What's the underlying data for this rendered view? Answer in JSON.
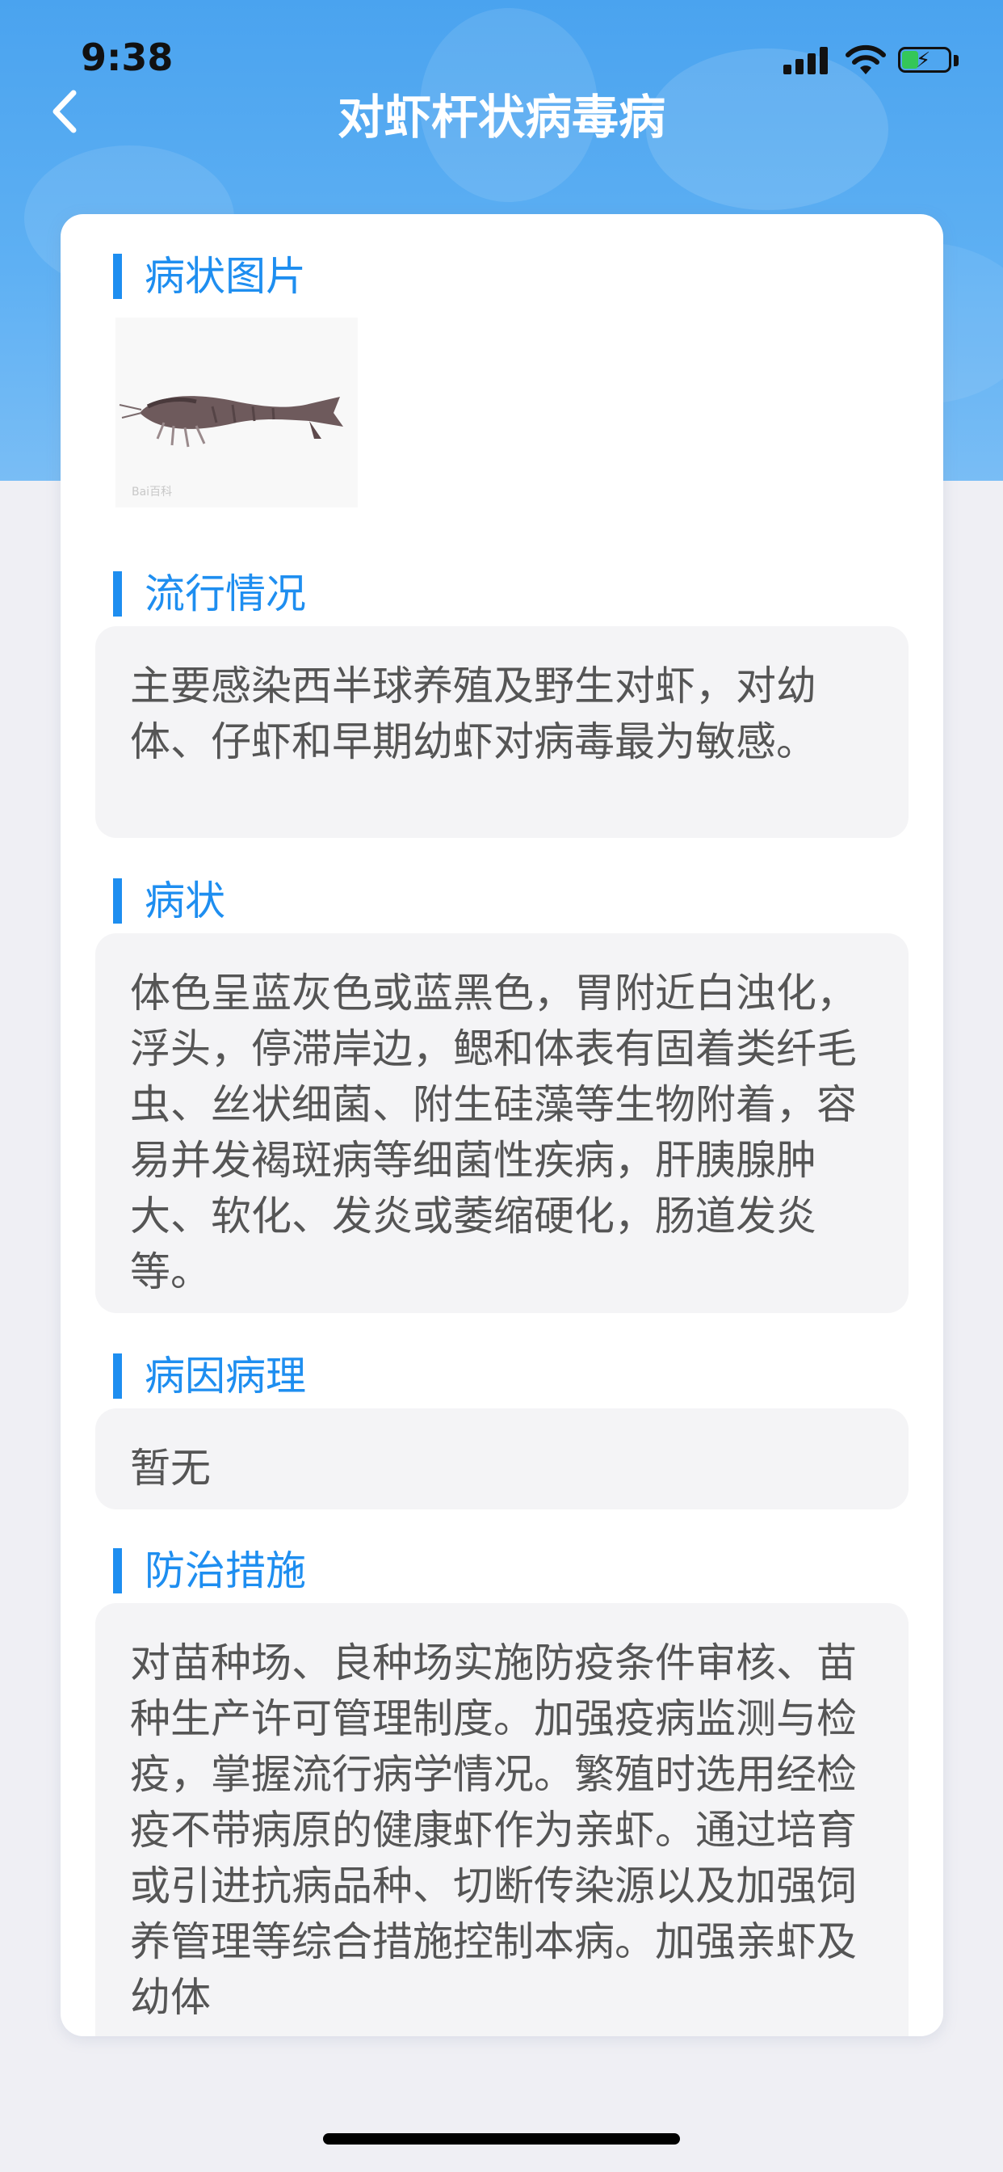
{
  "status_bar": {
    "time": "9:38"
  },
  "header": {
    "title": "对虾杆状病毒病"
  },
  "sections": [
    {
      "title": "病状图片"
    },
    {
      "title": "流行情况",
      "text": "主要感染西半球养殖及野生对虾，对幼体、仔虾和早期幼虾对病毒最为敏感。"
    },
    {
      "title": "病状",
      "text": "体色呈蓝灰色或蓝黑色，胃附近白浊化，浮头，停滞岸边，鳃和体表有固着类纤毛虫、丝状细菌、附生硅藻等生物附着，容易并发褐斑病等细菌性疾病，肝胰腺肿大、软化、发炎或萎缩硬化，肠道发炎等。"
    },
    {
      "title": "病因病理",
      "text": "暂无"
    },
    {
      "title": "防治措施",
      "text": "对苗种场、良种场实施防疫条件审核、苗种生产许可管理制度。加强疫病监测与检疫，掌握流行病学情况。繁殖时选用经检疫不带病原的健康虾作为亲虾。通过培育或引进抗病品种、切断传染源以及加强饲养管理等综合措施控制本病。加强亲虾及幼体"
    }
  ],
  "colors": {
    "accent": "#1e8ef0",
    "header_bg": "#4aa3ef",
    "text_box_bg": "#f4f4f6",
    "page_bg": "#efeff4"
  }
}
